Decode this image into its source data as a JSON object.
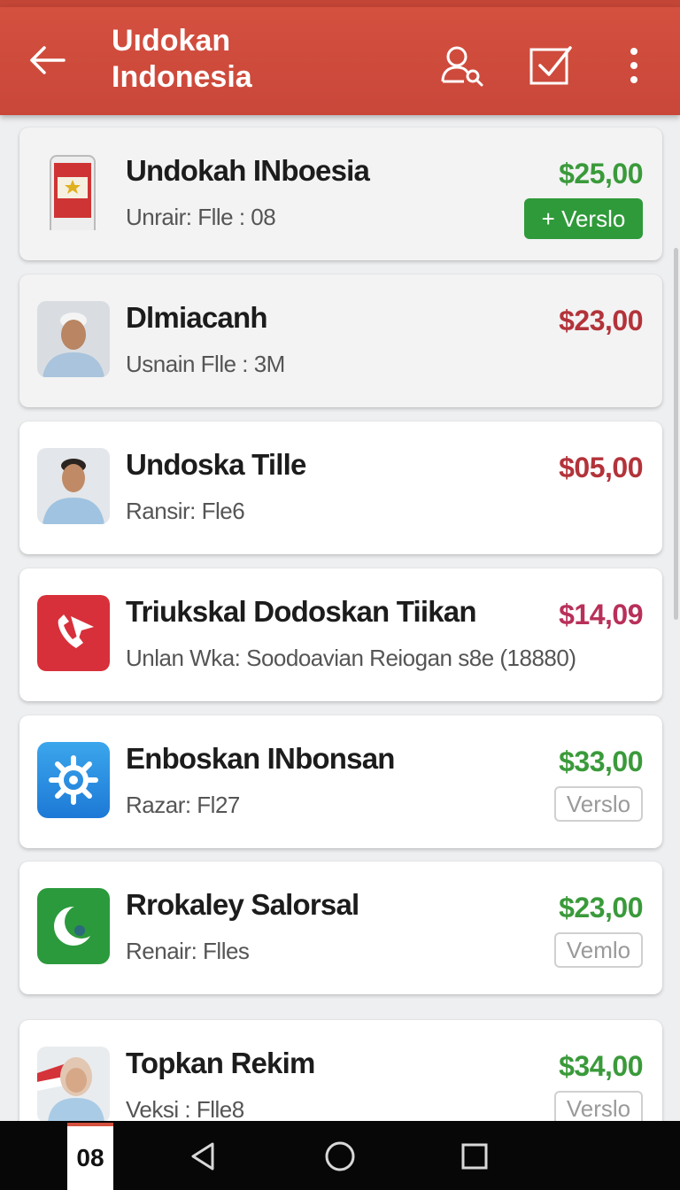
{
  "app_bar": {
    "title": "Uıdokan\nIndonesia",
    "icons": [
      "back-arrow-icon",
      "user-search-icon",
      "checkbox-icon",
      "more-vert-icon"
    ]
  },
  "colors": {
    "app_bar": "#c9473a",
    "price_green": "#3a9a3a",
    "price_red": "#b3333a",
    "price_magenta": "#b8305a",
    "version_button": "#2f9a3a"
  },
  "items": [
    {
      "title": "Undokah INboesia",
      "subtitle": "Unrair: Flle : 08",
      "price": "$25,00",
      "price_color": "#3a9a3a",
      "button": "+ Verslo",
      "button_style": "solid",
      "icon": "phone-flag-icon"
    },
    {
      "title": "Dlmiacanh",
      "subtitle": "Usnain Flle : 3M",
      "price": "$23,00",
      "price_color": "#b3333a",
      "button": "",
      "button_style": "none",
      "icon": "person-photo-icon"
    },
    {
      "title": "Undoska Tille",
      "subtitle": "Ransir: Fle6",
      "price": "$05,00",
      "price_color": "#b3333a",
      "button": "",
      "button_style": "none",
      "icon": "person-photo-icon"
    },
    {
      "title": "Triukskal Dodoskan Tiikan",
      "subtitle": "Unlan Wka: Soodoavian Reiogan s8e (18880)",
      "price": "$14,09",
      "price_color": "#b8305a",
      "button": "",
      "button_style": "none",
      "icon": "phone-call-icon"
    },
    {
      "title": "Enboskan INbonsan",
      "subtitle": "Razar: Fl27",
      "price": "$33,00",
      "price_color": "#3a9a3a",
      "button": "Verslo",
      "button_style": "outline",
      "icon": "gear-app-icon"
    },
    {
      "title": "Rrokaley Salorsal",
      "subtitle": "Renair: Flles",
      "price": "$23,00",
      "price_color": "#3a9a3a",
      "button": "Vemlo",
      "button_style": "outline",
      "icon": "crescent-app-icon"
    },
    {
      "title": "Topkan Rekim",
      "subtitle": "Veksi : Flle8",
      "price": "$34,00",
      "price_color": "#3a9a3a",
      "button": "Verslo",
      "button_style": "outline",
      "icon": "person-photo-icon"
    }
  ],
  "nav_bar": {
    "badge": "08",
    "icons": [
      "back-triangle-icon",
      "home-circle-icon",
      "recents-square-icon"
    ]
  }
}
